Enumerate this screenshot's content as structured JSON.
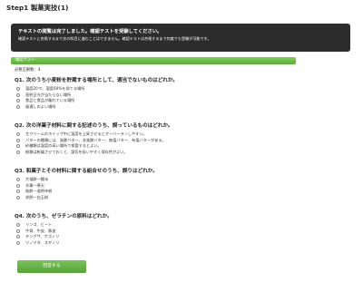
{
  "header": {
    "title": "Step1 製菓実技(1)"
  },
  "notice": {
    "line1": "テキストの閲覧は完了しました。確認テストを受験してください。",
    "line2": "確認テストに合格するまで次の科目に進むことはできません。確認テストは合格するまで何度でも受験が可能です。"
  },
  "test": {
    "bar_label": "確認テスト",
    "answered_label": "必要正解数：4",
    "questions": [
      {
        "title": "Q1. 次のうち小麦粉を貯蔵する場所として、適当でないものはどれか。",
        "options": [
          "温度20℃、湿度60%を保てる場所",
          "直射日光が当たらない場所",
          "食品と食品が離れている場所",
          "湿気の多い場所",
          "風通しのよい場所"
        ]
      },
      {
        "title": "Q2. 次の洋菓子材料に関する記述のうち、誤っているものはどれか。",
        "options": [
          "生クリームのホイップ中に温度を上昇させるとオーバーランしやすい。",
          "バターの種類には、発酵バター、非発酵バター、無塩バター、有塩バターがある。",
          "砂糖類は湿度の高い場所で保管するとよい。",
          "粉類は乾燥させておくと、湿気を吸いやすく保存性がよい。"
        ]
      },
      {
        "title": "Q3. 和菓子とその材料に関する組合せのうち、誤りはどれか。",
        "options": [
          "大福餅―糯米",
          "羊羹―寒天",
          "桜餅―道明寺粉",
          "求肥―白玉粉"
        ]
      },
      {
        "title": "Q4. 次のうち、ゼラチンの原料はどれか。",
        "options": [
          "リンゴ、ビート",
          "牛骨、牛皮、豚皮",
          "テングサ、オゴノリ",
          "ツノマタ、スギノリ"
        ]
      }
    ]
  },
  "submit": {
    "label": "回答する"
  },
  "colors": {
    "accent": "#5aae33",
    "notice_bg": "#2c2c2c"
  }
}
